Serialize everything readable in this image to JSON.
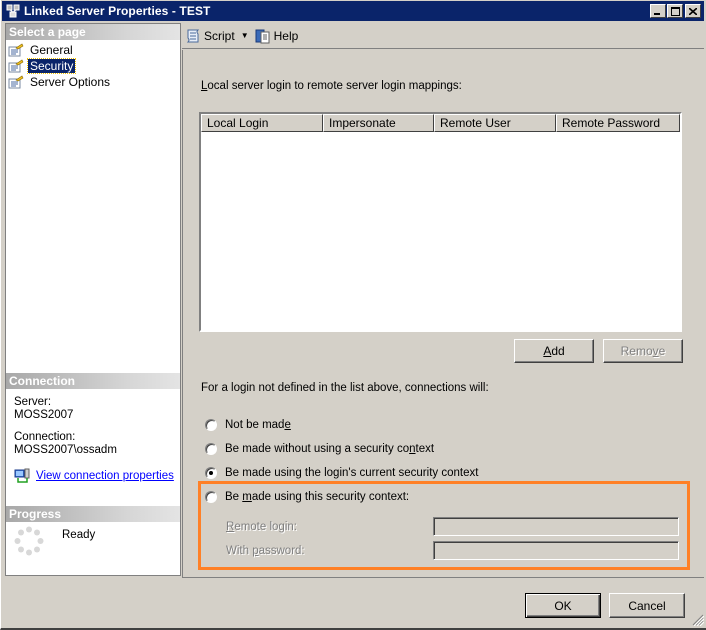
{
  "window": {
    "title": "Linked Server Properties - TEST",
    "controls": [
      "minimize",
      "maximize",
      "close"
    ]
  },
  "left_pane": {
    "select_page_header": "Select a page",
    "pages": [
      {
        "label": "General",
        "icon": "page-icon",
        "selected": false
      },
      {
        "label": "Security",
        "icon": "page-icon",
        "selected": true
      },
      {
        "label": "Server Options",
        "icon": "page-icon",
        "selected": false
      }
    ],
    "connection": {
      "header": "Connection",
      "server_label": "Server:",
      "server_value": "MOSS2007",
      "connection_label": "Connection:",
      "connection_value": "MOSS2007\\ossadm",
      "view_link": "View connection properties"
    },
    "progress": {
      "header": "Progress",
      "status": "Ready"
    }
  },
  "toolbar": {
    "script_label": "Script",
    "help_label": "Help"
  },
  "security": {
    "mappings_label_prefix": "",
    "mappings_label_access": "L",
    "mappings_label_rest": "ocal server login to remote server login mappings:",
    "grid_columns": [
      "Local Login",
      "Impersonate",
      "Remote User",
      "Remote Password"
    ],
    "grid_rows": [],
    "add_access": "A",
    "add_rest": "dd",
    "remove_pre": "Remo",
    "remove_access": "v",
    "remove_post": "e",
    "remove_disabled": true,
    "for_login_label": "For a login not defined in the list above, connections will:",
    "options": [
      {
        "pre": "Not be mad",
        "access": "e",
        "post": "",
        "checked": false
      },
      {
        "pre": "Be made without using a security co",
        "access": "n",
        "post": "text",
        "checked": false
      },
      {
        "pre": "Be made using the login's current security context",
        "access": "",
        "post": "",
        "checked": true
      },
      {
        "pre": "Be ",
        "access": "m",
        "post": "ade using this security context:",
        "checked": false
      }
    ],
    "remote_login": {
      "access": "R",
      "rest": "emote login:",
      "value": "",
      "disabled": true
    },
    "with_password": {
      "pre": "With ",
      "access": "p",
      "rest": "assword:",
      "value": "",
      "disabled": true
    },
    "highlight_color": "#ff8026"
  },
  "footer": {
    "ok_label": "OK",
    "cancel_label": "Cancel"
  }
}
